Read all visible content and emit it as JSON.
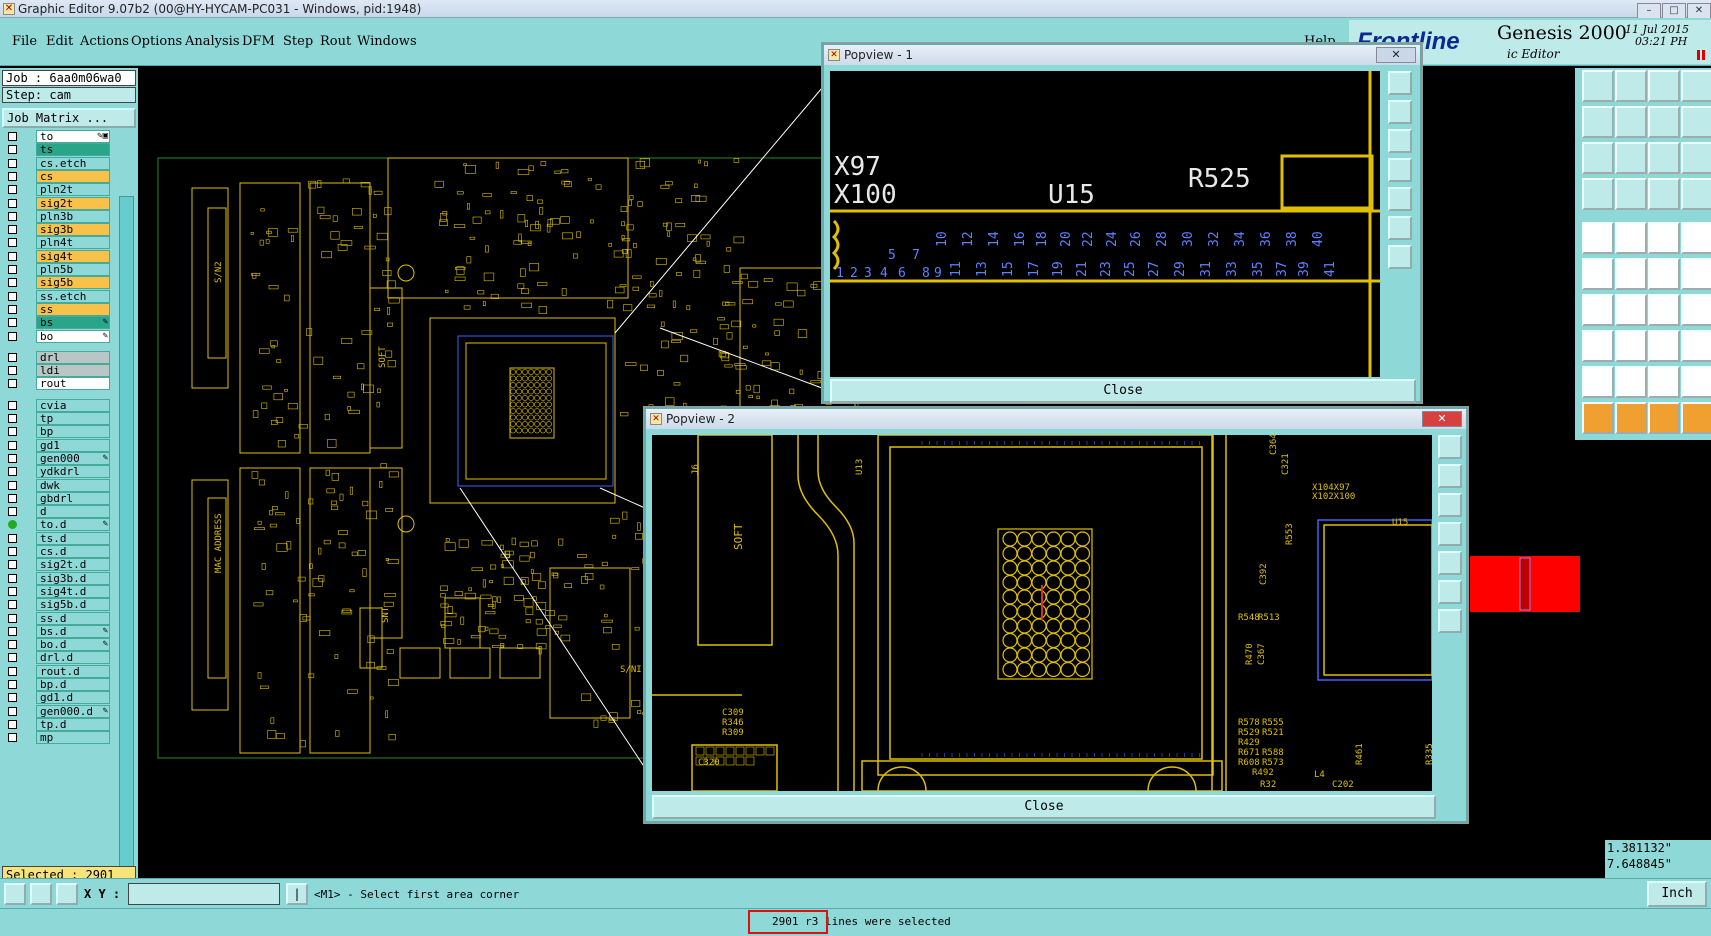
{
  "window": {
    "title": "Graphic Editor 9.07b2 (00@HY-HYCAM-PC031 - Windows, pid:1948)"
  },
  "menu": [
    {
      "key": "file",
      "label": "File"
    },
    {
      "key": "edit",
      "label": "Edit"
    },
    {
      "key": "actions",
      "label": "Actions"
    },
    {
      "key": "options",
      "label": "Options"
    },
    {
      "key": "analysis",
      "label": "Analysis"
    },
    {
      "key": "dfm",
      "label": "DFM"
    },
    {
      "key": "step",
      "label": "Step"
    },
    {
      "key": "rout",
      "label": "Rout"
    },
    {
      "key": "windows",
      "label": "Windows"
    }
  ],
  "menu_help": "Help",
  "brand": {
    "logo": "Frontline",
    "product": "Genesis 2000",
    "subtitle": "ic Editor",
    "date": "11 Jul 2015",
    "time": "03:21 PH"
  },
  "job": {
    "job_line": "Job : 6aa0m06wa0",
    "step_line": "Step: cam",
    "matrix_button": "Job Matrix ..."
  },
  "layers": [
    {
      "name": "to",
      "color": "#ffffff",
      "mark": "✎▣"
    },
    {
      "name": "ts",
      "color": "#2aa58a"
    },
    {
      "name": "cs.etch",
      "color": "#8fd8d8"
    },
    {
      "name": "cs",
      "color": "#f7c14a"
    },
    {
      "name": "pln2t",
      "color": "#8fd8d8"
    },
    {
      "name": "sig2t",
      "color": "#f7c14a"
    },
    {
      "name": "pln3b",
      "color": "#8fd8d8"
    },
    {
      "name": "sig3b",
      "color": "#f7c14a"
    },
    {
      "name": "pln4t",
      "color": "#8fd8d8"
    },
    {
      "name": "sig4t",
      "color": "#f7c14a"
    },
    {
      "name": "pln5b",
      "color": "#8fd8d8"
    },
    {
      "name": "sig5b",
      "color": "#f7c14a"
    },
    {
      "name": "ss.etch",
      "color": "#8fd8d8"
    },
    {
      "name": "ss",
      "color": "#f7c14a"
    },
    {
      "name": "bs",
      "color": "#2aa58a",
      "mark": "✎"
    },
    {
      "name": "bo",
      "color": "#ffffff",
      "mark": "✎"
    },
    {
      "name": "drl",
      "color": "#b8c6c6"
    },
    {
      "name": "ldi",
      "color": "#b8c6c6"
    },
    {
      "name": "rout",
      "color": "#ffffff"
    },
    {
      "name": "cvia",
      "color": "#8fd8d8"
    },
    {
      "name": "tp",
      "color": "#8fd8d8"
    },
    {
      "name": "bp",
      "color": "#8fd8d8"
    },
    {
      "name": "gd1",
      "color": "#8fd8d8"
    },
    {
      "name": "gen000",
      "color": "#8fd8d8",
      "mark": "✎"
    },
    {
      "name": "ydkdrl",
      "color": "#8fd8d8"
    },
    {
      "name": "dwk",
      "color": "#8fd8d8"
    },
    {
      "name": "gbdrl",
      "color": "#8fd8d8"
    },
    {
      "name": "d",
      "color": "#8fd8d8"
    },
    {
      "name": "to.d",
      "color": "#8fd8d8",
      "mark": "✎",
      "active": true
    },
    {
      "name": "ts.d",
      "color": "#8fd8d8"
    },
    {
      "name": "cs.d",
      "color": "#8fd8d8"
    },
    {
      "name": "sig2t.d",
      "color": "#8fd8d8"
    },
    {
      "name": "sig3b.d",
      "color": "#8fd8d8"
    },
    {
      "name": "sig4t.d",
      "color": "#8fd8d8"
    },
    {
      "name": "sig5b.d",
      "color": "#8fd8d8"
    },
    {
      "name": "ss.d",
      "color": "#8fd8d8"
    },
    {
      "name": "bs.d",
      "color": "#8fd8d8",
      "mark": "✎"
    },
    {
      "name": "bo.d",
      "color": "#8fd8d8",
      "mark": "✎"
    },
    {
      "name": "drl.d",
      "color": "#8fd8d8"
    },
    {
      "name": "rout.d",
      "color": "#8fd8d8"
    },
    {
      "name": "bp.d",
      "color": "#8fd8d8"
    },
    {
      "name": "gd1.d",
      "color": "#8fd8d8"
    },
    {
      "name": "gen000.d",
      "color": "#8fd8d8",
      "mark": "✎"
    },
    {
      "name": "tp.d",
      "color": "#8fd8d8"
    },
    {
      "name": "mp",
      "color": "#8fd8d8"
    }
  ],
  "selected": "Selected : 2901",
  "cmd": {
    "xy_label": "X Y :",
    "xy_value": "",
    "prompt": "<M1> - Select first area corner"
  },
  "status": "2901 r3 lines were selected",
  "coords": {
    "x": "1.381132\"",
    "y": "7.648845\""
  },
  "units": "Inch",
  "board_labels": {
    "softlabel": "SOFT",
    "snt": "SNT",
    "sn": "S/NI",
    "macaddress": "MAC ADDRESS",
    "snbox": "S/N2"
  },
  "popview1": {
    "title": "Popview - 1",
    "close": "Close",
    "refdes": [
      "X97",
      "X100",
      "U15",
      "R525"
    ],
    "pins_top": [
      "5",
      "7",
      "10",
      "12",
      "14",
      "16",
      "18",
      "20",
      "22",
      "24",
      "26",
      "28",
      "30",
      "32",
      "34",
      "36",
      "38",
      "40"
    ],
    "pins_bottom": [
      "1",
      "2",
      "3",
      "4",
      "6",
      "8",
      "9",
      "11",
      "13",
      "15",
      "17",
      "19",
      "21",
      "23",
      "25",
      "27",
      "29",
      "31",
      "33",
      "35",
      "37",
      "39",
      "41"
    ]
  },
  "popview2": {
    "title": "Popview - 2",
    "close": "Close",
    "labels": [
      "J6",
      "SOFT",
      "U13",
      "U15",
      "X104X97",
      "X102X100",
      "C364",
      "C321",
      "R553",
      "C392",
      "R548",
      "R513",
      "R470",
      "C367",
      "R578",
      "R555",
      "R529",
      "R521",
      "R429",
      "R671",
      "R588",
      "R608",
      "R573",
      "R492",
      "R461",
      "R32",
      "C309",
      "R346",
      "R309",
      "C320",
      "C202",
      "L4",
      "R335"
    ]
  },
  "colors": {
    "panel": "#8fd8d8",
    "pcb": "#e0c000",
    "canvas": "#000000",
    "highlight": "#4060ff",
    "selection_red": "#ff0000"
  }
}
